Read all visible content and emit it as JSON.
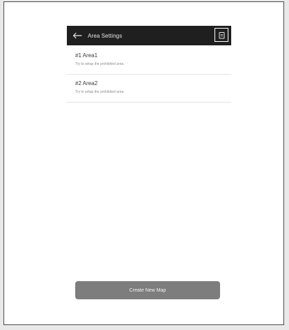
{
  "header": {
    "title": "Area Settings",
    "back_icon": "arrow-left-icon",
    "action_icon": "clipboard-icon",
    "background": "#1f1f1f"
  },
  "areas": [
    {
      "title": "#1 Area1",
      "subtitle": "Try to setup the prohibited area."
    },
    {
      "title": "#2 Area2",
      "subtitle": "Try to setup the prohibited area."
    }
  ],
  "create_button": {
    "label": "Create New Map",
    "background": "#7d7d7d"
  }
}
